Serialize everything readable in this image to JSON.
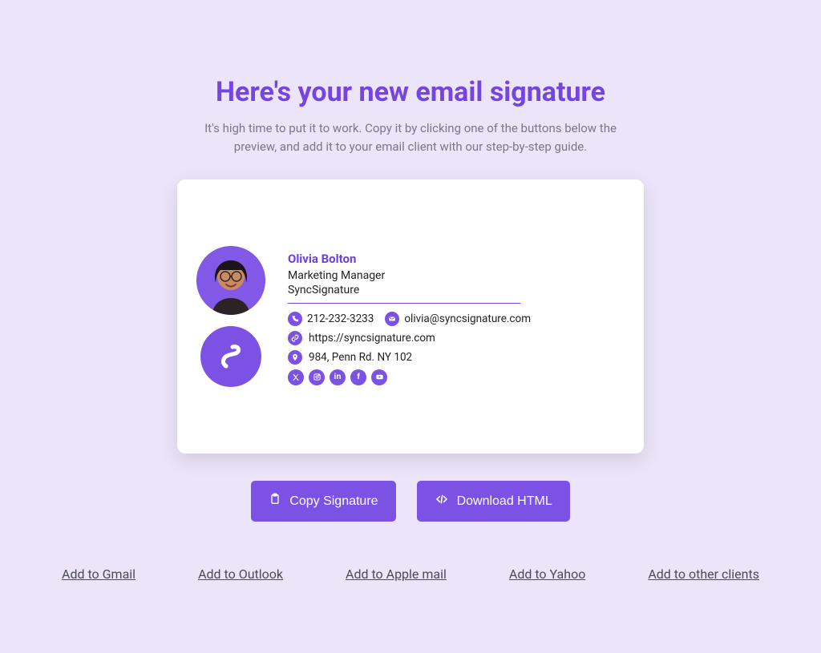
{
  "header": {
    "title": "Here's your new email signature",
    "subtitle": "It's high time to put it to work. Copy it by clicking one of the buttons below the preview, and add it to your email client with our step-by-step guide."
  },
  "signature": {
    "name": "Olivia Bolton",
    "role": "Marketing Manager",
    "company": "SyncSignature",
    "phone": "212-232-3233",
    "email": "olivia@syncsignature.com",
    "website": "https://syncsignature.com",
    "address": "984, Penn Rd. NY 102",
    "socials": [
      "twitter-x",
      "instagram",
      "linkedin",
      "facebook",
      "youtube"
    ]
  },
  "buttons": {
    "copy": "Copy Signature",
    "download": "Download HTML"
  },
  "links": {
    "gmail": "Add to Gmail",
    "outlook": "Add to Outlook",
    "apple": "Add to Apple mail",
    "yahoo": "Add to Yahoo",
    "other": "Add to other clients"
  }
}
